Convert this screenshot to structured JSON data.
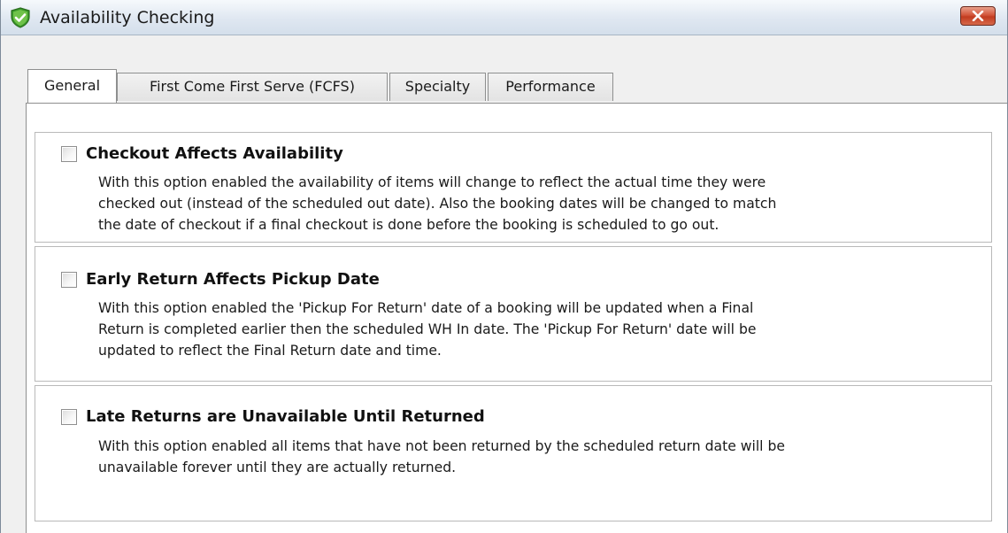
{
  "window": {
    "title": "Availability Checking",
    "icon": "shield-check-icon",
    "close_icon": "close-icon"
  },
  "tabs": [
    {
      "label": "General",
      "active": true
    },
    {
      "label": "First Come First Serve (FCFS)",
      "active": false
    },
    {
      "label": "Specialty",
      "active": false
    },
    {
      "label": "Performance",
      "active": false
    }
  ],
  "options": [
    {
      "title": "Checkout Affects Availability",
      "checked": false,
      "description": "With this option enabled the availability of items will change to reflect the actual time they were\nchecked out (instead of the scheduled out date). Also the booking dates will be changed to match\nthe date of checkout if a final checkout is done before the booking is scheduled to go out."
    },
    {
      "title": "Early Return Affects Pickup Date",
      "checked": false,
      "description": "With this option enabled the 'Pickup For Return' date of a booking will be updated when a Final\nReturn is completed earlier then the scheduled WH In date. The 'Pickup For Return' date will be\nupdated to reflect the Final Return date and time."
    },
    {
      "title": "Late Returns are Unavailable Until Returned",
      "checked": false,
      "description": "With this option enabled all items that have not been returned by the scheduled return date will be\nunavailable forever until they are actually returned."
    }
  ],
  "colors": {
    "titlebar": "#dfe7f1",
    "close_button": "#c23b1f",
    "icon_green": "#3a9a2a"
  }
}
